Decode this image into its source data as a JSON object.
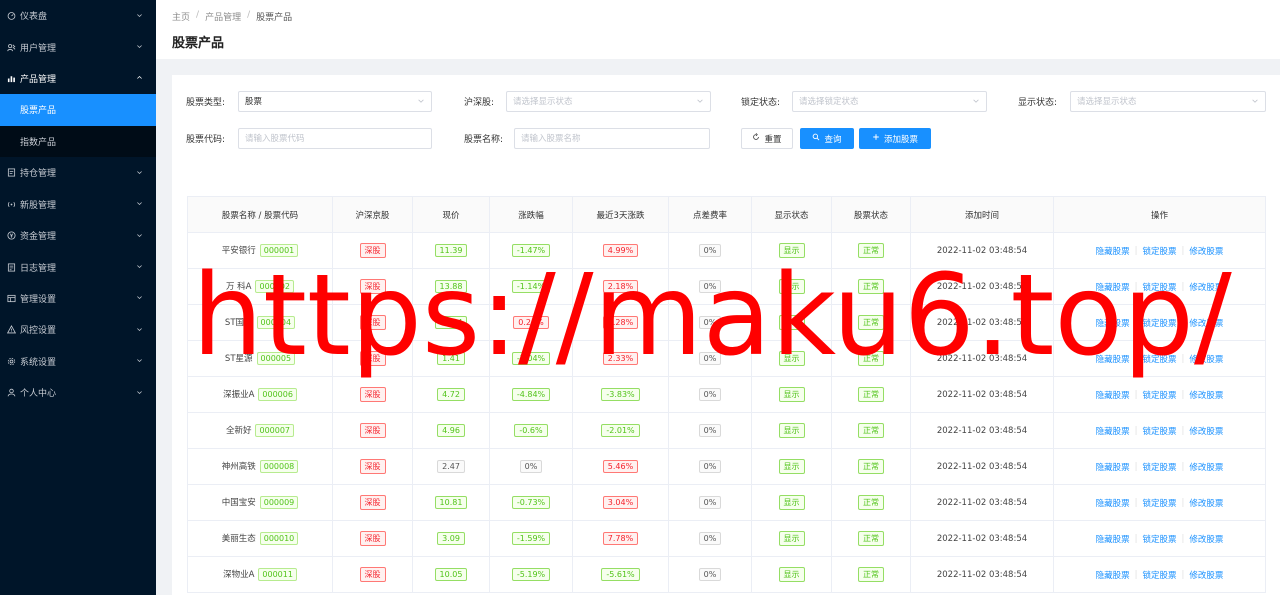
{
  "sidebar": {
    "items": [
      {
        "label": "仪表盘",
        "icon": "dashboard-icon",
        "open": false
      },
      {
        "label": "用户管理",
        "icon": "users-icon",
        "open": false
      },
      {
        "label": "产品管理",
        "icon": "chart-bar-icon",
        "open": true
      },
      {
        "label": "持仓管理",
        "icon": "position-icon",
        "open": false
      },
      {
        "label": "新股管理",
        "icon": "signal-icon",
        "open": false
      },
      {
        "label": "资金管理",
        "icon": "money-icon",
        "open": false
      },
      {
        "label": "日志管理",
        "icon": "log-icon",
        "open": false
      },
      {
        "label": "管理设置",
        "icon": "settings-panel-icon",
        "open": false
      },
      {
        "label": "风控设置",
        "icon": "risk-icon",
        "open": false
      },
      {
        "label": "系统设置",
        "icon": "gear-icon",
        "open": false
      },
      {
        "label": "个人中心",
        "icon": "user-icon",
        "open": false
      }
    ],
    "submenu": [
      {
        "label": "股票产品",
        "active": true
      },
      {
        "label": "指数产品",
        "active": false
      }
    ]
  },
  "header": {
    "breadcrumb": [
      "主页",
      "产品管理",
      "股票产品"
    ],
    "title": "股票产品"
  },
  "filters": {
    "stock_type": {
      "label": "股票类型:",
      "value": "股票"
    },
    "exchange": {
      "label": "沪深股:",
      "placeholder": "请选择显示状态"
    },
    "lock_status": {
      "label": "锁定状态:",
      "placeholder": "请选择锁定状态"
    },
    "display_status": {
      "label": "显示状态:",
      "placeholder": "请选择显示状态"
    },
    "stock_code": {
      "label": "股票代码:",
      "placeholder": "请输入股票代码"
    },
    "stock_name": {
      "label": "股票名称:",
      "placeholder": "请输入股票名称"
    },
    "reset_label": "重置",
    "search_label": "查询",
    "add_label": "添加股票"
  },
  "table": {
    "columns": [
      "股票名称 / 股票代码",
      "沪深京股",
      "现价",
      "涨跌幅",
      "最近3天涨跌",
      "点差费率",
      "显示状态",
      "股票状态",
      "添加时间",
      "操作"
    ],
    "op_labels": [
      "隐藏股票",
      "锁定股票",
      "修改股票"
    ],
    "rows": [
      {
        "name": "平安银行",
        "code": "000001",
        "market": "深股",
        "price": "11.39",
        "change": "-1.47%",
        "change3d": "4.99%",
        "spread": "0%",
        "display": "显示",
        "status": "正常",
        "time": "2022-11-02 03:48:54"
      },
      {
        "name": "万 科A",
        "code": "000002",
        "market": "深股",
        "price": "13.88",
        "change": "-1.14%",
        "change3d": "2.18%",
        "spread": "0%",
        "display": "显示",
        "status": "正常",
        "time": "2022-11-02 03:48:54"
      },
      {
        "name": "ST国华",
        "code": "000004",
        "market": "深股",
        "price": "10.44",
        "change": "0.24%",
        "change3d": "0.28%",
        "spread": "0%",
        "display": "显示",
        "status": "正常",
        "time": "2022-11-02 03:48:54"
      },
      {
        "name": "ST星源",
        "code": "000005",
        "market": "深股",
        "price": "1.41",
        "change": "-2.04%",
        "change3d": "2.33%",
        "spread": "0%",
        "display": "显示",
        "status": "正常",
        "time": "2022-11-02 03:48:54"
      },
      {
        "name": "深振业A",
        "code": "000006",
        "market": "深股",
        "price": "4.72",
        "change": "-4.84%",
        "change3d": "-3.83%",
        "spread": "0%",
        "display": "显示",
        "status": "正常",
        "time": "2022-11-02 03:48:54"
      },
      {
        "name": "全新好",
        "code": "000007",
        "market": "深股",
        "price": "4.96",
        "change": "-0.6%",
        "change3d": "-2.01%",
        "spread": "0%",
        "display": "显示",
        "status": "正常",
        "time": "2022-11-02 03:48:54"
      },
      {
        "name": "神州高铁",
        "code": "000008",
        "market": "深股",
        "price": "2.47",
        "change": "0%",
        "change3d": "5.46%",
        "spread": "0%",
        "display": "显示",
        "status": "正常",
        "time": "2022-11-02 03:48:54"
      },
      {
        "name": "中国宝安",
        "code": "000009",
        "market": "深股",
        "price": "10.81",
        "change": "-0.73%",
        "change3d": "3.04%",
        "spread": "0%",
        "display": "显示",
        "status": "正常",
        "time": "2022-11-02 03:48:54"
      },
      {
        "name": "美丽生态",
        "code": "000010",
        "market": "深股",
        "price": "3.09",
        "change": "-1.59%",
        "change3d": "7.78%",
        "spread": "0%",
        "display": "显示",
        "status": "正常",
        "time": "2022-11-02 03:48:54"
      },
      {
        "name": "深物业A",
        "code": "000011",
        "market": "深股",
        "price": "10.05",
        "change": "-5.19%",
        "change3d": "-5.61%",
        "spread": "0%",
        "display": "显示",
        "status": "正常",
        "time": "2022-11-02 03:48:54"
      }
    ]
  },
  "watermark": "https://maku6.top/",
  "colors": {
    "sidebar_bg": "#001529",
    "active": "#1890ff",
    "up": "#f5222d",
    "down": "#52c41a",
    "watermark": "#ff0000"
  }
}
